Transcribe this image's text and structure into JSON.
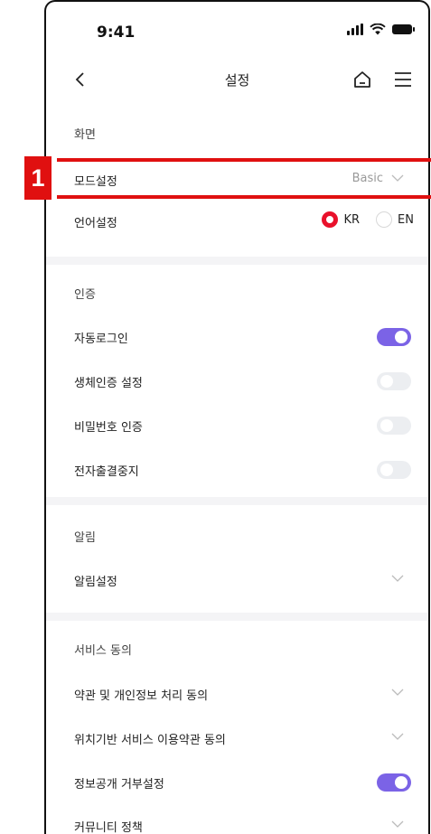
{
  "status_bar": {
    "time": "9:41"
  },
  "header": {
    "title": "설정"
  },
  "sections": {
    "display": {
      "title": "화면",
      "mode": {
        "label": "모드설정",
        "value": "Basic"
      },
      "language": {
        "label": "언어설정",
        "options": [
          "KR",
          "EN"
        ],
        "selected": "KR"
      }
    },
    "auth": {
      "title": "인증",
      "items": [
        {
          "label": "자동로그인",
          "on": true
        },
        {
          "label": "생체인증 설정",
          "on": false
        },
        {
          "label": "비밀번호 인증",
          "on": false
        },
        {
          "label": "전자출결중지",
          "on": false
        }
      ]
    },
    "alerts": {
      "title": "알림",
      "items": [
        {
          "label": "알림설정"
        }
      ]
    },
    "consent": {
      "title": "서비스 동의",
      "items": [
        {
          "label": "약관 및 개인정보 처리 동의"
        },
        {
          "label": "위치기반 서비스 이용약관 동의"
        },
        {
          "label": "정보공개 거부설정",
          "on": true
        },
        {
          "label": "커뮤니티 정책"
        }
      ]
    }
  },
  "annotation": {
    "callout": "1"
  },
  "colors": {
    "accent_toggle": "#7b63e6",
    "radio_selected": "#e9112b",
    "annotation": "#e01010"
  }
}
